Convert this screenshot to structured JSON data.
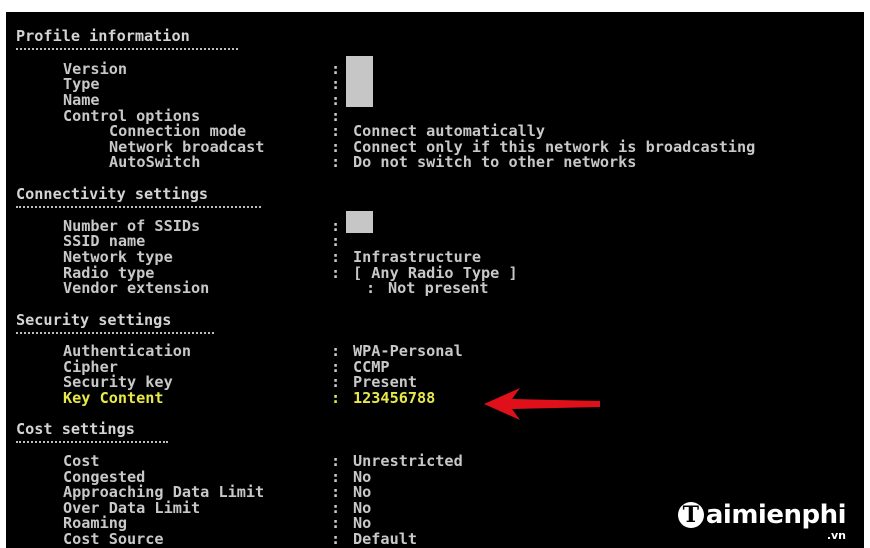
{
  "profile": {
    "title": "Profile information",
    "rows": [
      {
        "label": "Version",
        "sep": ":",
        "value": ""
      },
      {
        "label": "Type",
        "sep": ":",
        "value": ""
      },
      {
        "label": "Name",
        "sep": ":",
        "value": ""
      },
      {
        "label": "Control options",
        "sep": ":",
        "value": ""
      },
      {
        "label": "Connection mode",
        "sep": ":",
        "value": "Connect automatically"
      },
      {
        "label": "Network broadcast",
        "sep": ":",
        "value": "Connect only if this network is broadcasting"
      },
      {
        "label": "AutoSwitch",
        "sep": ":",
        "value": "Do not switch to other networks"
      }
    ]
  },
  "connectivity": {
    "title": "Connectivity settings",
    "rows": [
      {
        "label": "Number of SSIDs",
        "sep": ":",
        "value": ""
      },
      {
        "label": "SSID name",
        "sep": ":",
        "value": ""
      },
      {
        "label": "Network type",
        "sep": ":",
        "value": "Infrastructure"
      },
      {
        "label": "Radio type",
        "sep": ":",
        "value": "[ Any Radio Type ]"
      },
      {
        "label": "Vendor extension",
        "sep": ":",
        "value": "Not present"
      }
    ]
  },
  "security": {
    "title": "Security settings",
    "rows": [
      {
        "label": "Authentication",
        "sep": ":",
        "value": "WPA-Personal"
      },
      {
        "label": "Cipher",
        "sep": ":",
        "value": "CCMP"
      },
      {
        "label": "Security key",
        "sep": ":",
        "value": "Present"
      },
      {
        "label": "Key Content",
        "sep": ":",
        "value": "123456788"
      }
    ]
  },
  "cost": {
    "title": "Cost settings",
    "rows": [
      {
        "label": "Cost",
        "sep": ":",
        "value": "Unrestricted"
      },
      {
        "label": "Congested",
        "sep": ":",
        "value": "No"
      },
      {
        "label": "Approaching Data Limit",
        "sep": ":",
        "value": "No"
      },
      {
        "label": "Over Data Limit",
        "sep": ":",
        "value": "No"
      },
      {
        "label": "Roaming",
        "sep": ":",
        "value": "No"
      },
      {
        "label": "Cost Source",
        "sep": ":",
        "value": "Default"
      }
    ]
  },
  "watermark": {
    "brand": "aimienphi",
    "initial": "T",
    "suffix": ".vn"
  },
  "colors": {
    "background": "#000000",
    "text": "#c8c8c8",
    "highlight": "#e8e84a",
    "arrow": "#e0101a"
  },
  "icons": {
    "pointer": "red-arrow-icon"
  }
}
